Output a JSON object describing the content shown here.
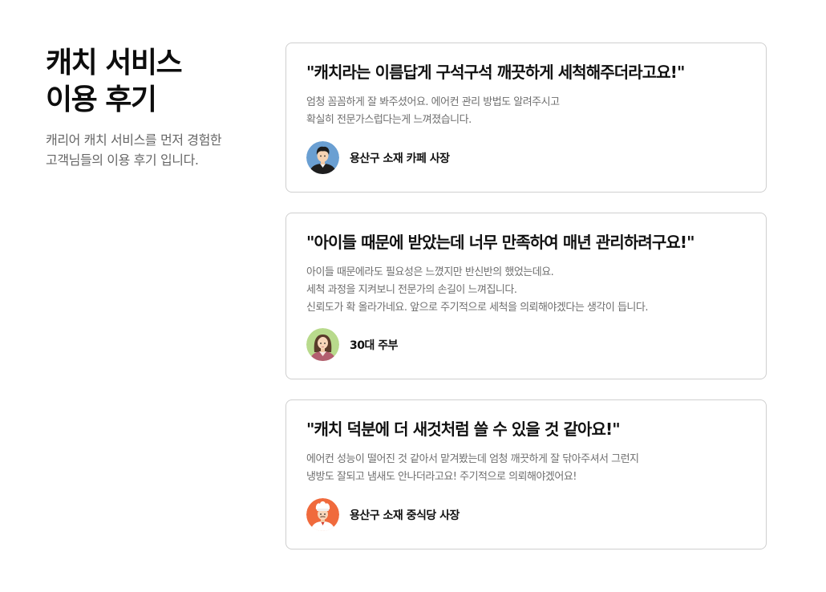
{
  "intro": {
    "title": "캐치 서비스\n이용 후기",
    "description": "캐리어 캐치 서비스를 먼저 경험한\n고객님들의 이용 후기 입니다."
  },
  "reviews": [
    {
      "quote": "\"캐치라는 이름답게 구석구석 깨끗하게 세척해주더라고요!\"",
      "body": "엄청 꼼꼼하게 잘 봐주셨어요. 에어컨 관리 방법도 알려주시고\n확실히 전문가스럽다는게 느껴졌습니다.",
      "reviewer": "용산구 소재 카페 사장",
      "avatar_icon": "man-avatar-icon",
      "avatar_color": "#6a9fd2"
    },
    {
      "quote": "\"아이들 때문에 받았는데 너무 만족하여 매년 관리하려구요!\"",
      "body": "아이들 때문에라도 필요성은 느꼈지만 반신반의 했었는데요.\n세척 과정을 지켜보니 전문가의 손길이 느껴집니다.\n신뢰도가 확 올라가네요. 앞으로 주기적으로 세척을 의뢰해야겠다는 생각이 듭니다.",
      "reviewer": "30대 주부",
      "avatar_icon": "woman-avatar-icon",
      "avatar_color": "#b8da8c"
    },
    {
      "quote": "\"캐치 덕분에 더 새것처럼 쓸 수 있을 것 같아요!\"",
      "body": "에어컨 성능이 떨어진 것 같아서 맡겨봤는데 엄청 깨끗하게 잘 닦아주셔서 그런지\n냉방도 잘되고 냄새도 안나더라고요! 주기적으로 의뢰해야겠어요!",
      "reviewer": "용산구 소재 중식당 사장",
      "avatar_icon": "chef-avatar-icon",
      "avatar_color": "#f06a3c"
    }
  ]
}
